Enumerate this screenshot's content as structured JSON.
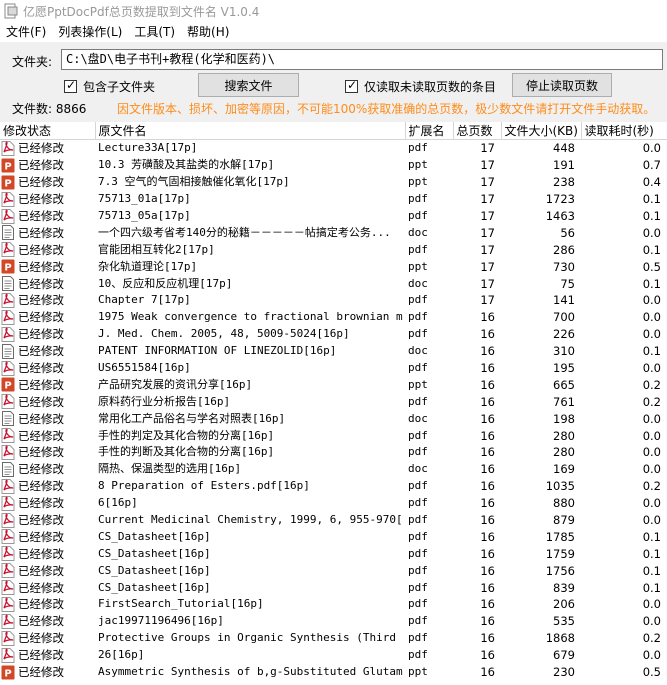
{
  "window": {
    "title": "亿愿PptDocPdf总页数提取到文件名 V1.0.4"
  },
  "menu": [
    "文件(F)",
    "列表操作(L)",
    "工具(T)",
    "帮助(H)"
  ],
  "folder": {
    "label": "文件夹:",
    "path": "C:\\盘D\\电子书刊+教程(化学和医药)\\"
  },
  "options": {
    "include_subfolders": {
      "label": "包含子文件夹",
      "checked": true
    },
    "search_button": "搜索文件",
    "only_unread": {
      "label": "仅读取未读取页数的条目",
      "checked": true
    },
    "stop_button": "停止读取页数"
  },
  "file_count_label": "文件数: 8866",
  "notice": "因文件版本、损坏、加密等原因，不可能100%获取准确的总页数，极少数文件请打开文件手动获取。",
  "colors": {
    "pdf": "#c8102e",
    "ppt": "#d24726",
    "doc": "#6b6b6b",
    "notice": "#ff8c1a"
  },
  "columns": [
    "修改状态",
    "原文件名",
    "扩展名",
    "总页数",
    "文件大小(KB)",
    "读取耗时(秒)"
  ],
  "rows": [
    {
      "status": "已经修改",
      "name": "Lecture33A[17p]",
      "ext": "pdf",
      "pages": "17",
      "size": "448",
      "time": "0.0"
    },
    {
      "status": "已经修改",
      "name": "10.3 芳磺酸及其盐类的水解[17p]",
      "ext": "ppt",
      "pages": "17",
      "size": "191",
      "time": "0.7"
    },
    {
      "status": "已经修改",
      "name": "7.3 空气的气固相接触催化氧化[17p]",
      "ext": "ppt",
      "pages": "17",
      "size": "238",
      "time": "0.4"
    },
    {
      "status": "已经修改",
      "name": "75713_01a[17p]",
      "ext": "pdf",
      "pages": "17",
      "size": "1723",
      "time": "0.1"
    },
    {
      "status": "已经修改",
      "name": "75713_05a[17p]",
      "ext": "pdf",
      "pages": "17",
      "size": "1463",
      "time": "0.1"
    },
    {
      "status": "已经修改",
      "name": "一个四六级考省考140分的秘籍－－－－－帖搞定考公务...",
      "ext": "doc",
      "pages": "17",
      "size": "56",
      "time": "0.0"
    },
    {
      "status": "已经修改",
      "name": "官能团相互转化2[17p]",
      "ext": "pdf",
      "pages": "17",
      "size": "286",
      "time": "0.1"
    },
    {
      "status": "已经修改",
      "name": "杂化轨道理论[17p]",
      "ext": "ppt",
      "pages": "17",
      "size": "730",
      "time": "0.5"
    },
    {
      "status": "已经修改",
      "name": "10、反应和反应机理[17p]",
      "ext": "doc",
      "pages": "17",
      "size": "75",
      "time": "0.1"
    },
    {
      "status": "已经修改",
      "name": "Chapter 7[17p]",
      "ext": "pdf",
      "pages": "17",
      "size": "141",
      "time": "0.0"
    },
    {
      "status": "已经修改",
      "name": "1975 Weak convergence to fractional brownian m...",
      "ext": "pdf",
      "pages": "16",
      "size": "700",
      "time": "0.0"
    },
    {
      "status": "已经修改",
      "name": "J. Med. Chem. 2005, 48, 5009-5024[16p]",
      "ext": "pdf",
      "pages": "16",
      "size": "226",
      "time": "0.0"
    },
    {
      "status": "已经修改",
      "name": "PATENT INFORMATION OF LINEZOLID[16p]",
      "ext": "doc",
      "pages": "16",
      "size": "310",
      "time": "0.1"
    },
    {
      "status": "已经修改",
      "name": "US6551584[16p]",
      "ext": "pdf",
      "pages": "16",
      "size": "195",
      "time": "0.0"
    },
    {
      "status": "已经修改",
      "name": "产品研究发展的资讯分享[16p]",
      "ext": "ppt",
      "pages": "16",
      "size": "665",
      "time": "0.2"
    },
    {
      "status": "已经修改",
      "name": "原料药行业分析报告[16p]",
      "ext": "pdf",
      "pages": "16",
      "size": "761",
      "time": "0.2"
    },
    {
      "status": "已经修改",
      "name": "常用化工产品俗名与学名对照表[16p]",
      "ext": "doc",
      "pages": "16",
      "size": "198",
      "time": "0.0"
    },
    {
      "status": "已经修改",
      "name": "手性的判定及其化合物的分离[16p]",
      "ext": "pdf",
      "pages": "16",
      "size": "280",
      "time": "0.0"
    },
    {
      "status": "已经修改",
      "name": "手性的判断及其化合物的分离[16p]",
      "ext": "pdf",
      "pages": "16",
      "size": "280",
      "time": "0.0"
    },
    {
      "status": "已经修改",
      "name": "隔热、保温类型的选用[16p]",
      "ext": "doc",
      "pages": "16",
      "size": "169",
      "time": "0.0"
    },
    {
      "status": "已经修改",
      "name": "8 Preparation of Esters.pdf[16p]",
      "ext": "pdf",
      "pages": "16",
      "size": "1035",
      "time": "0.2"
    },
    {
      "status": "已经修改",
      "name": "6[16p]",
      "ext": "pdf",
      "pages": "16",
      "size": "880",
      "time": "0.0"
    },
    {
      "status": "已经修改",
      "name": "Current Medicinal Chemistry, 1999, 6, 955-970[...",
      "ext": "pdf",
      "pages": "16",
      "size": "879",
      "time": "0.0"
    },
    {
      "status": "已经修改",
      "name": "CS_Datasheet[16p]",
      "ext": "pdf",
      "pages": "16",
      "size": "1785",
      "time": "0.1"
    },
    {
      "status": "已经修改",
      "name": "CS_Datasheet[16p]",
      "ext": "pdf",
      "pages": "16",
      "size": "1759",
      "time": "0.1"
    },
    {
      "status": "已经修改",
      "name": "CS_Datasheet[16p]",
      "ext": "pdf",
      "pages": "16",
      "size": "1756",
      "time": "0.1"
    },
    {
      "status": "已经修改",
      "name": "CS_Datasheet[16p]",
      "ext": "pdf",
      "pages": "16",
      "size": "839",
      "time": "0.1"
    },
    {
      "status": "已经修改",
      "name": "FirstSearch_Tutorial[16p]",
      "ext": "pdf",
      "pages": "16",
      "size": "206",
      "time": "0.0"
    },
    {
      "status": "已经修改",
      "name": "jac19971196496[16p]",
      "ext": "pdf",
      "pages": "16",
      "size": "535",
      "time": "0.0"
    },
    {
      "status": "已经修改",
      "name": "Protective Groups in Organic Synthesis (Third ...",
      "ext": "pdf",
      "pages": "16",
      "size": "1868",
      "time": "0.2"
    },
    {
      "status": "已经修改",
      "name": "26[16p]",
      "ext": "pdf",
      "pages": "16",
      "size": "679",
      "time": "0.0"
    },
    {
      "status": "已经修改",
      "name": "Asymmetric Synthesis of b,g-Substituted Glutam...",
      "ext": "ppt",
      "pages": "16",
      "size": "230",
      "time": "0.5"
    }
  ]
}
